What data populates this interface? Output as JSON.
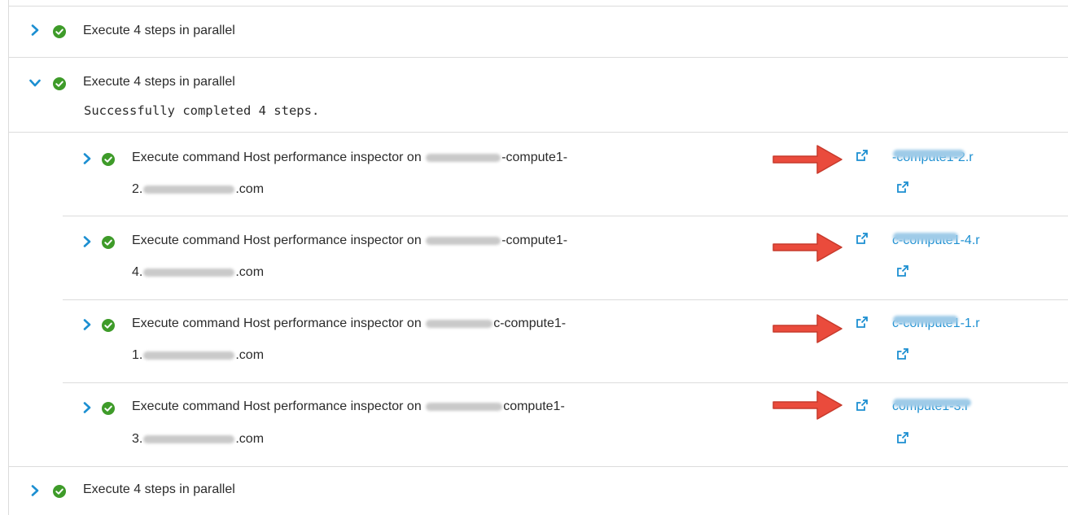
{
  "colors": {
    "accent": "#1c8fd1",
    "success": "#3e9b29",
    "arrow": "#ea4b3c"
  },
  "top_step": {
    "label": "Execute 4 steps in parallel",
    "expanded": false,
    "status": "success"
  },
  "expanded_step": {
    "label": "Execute 4 steps in parallel",
    "expanded": true,
    "status": "success",
    "message": "Successfully completed 4 steps.",
    "children": [
      {
        "line1_prefix": "Execute command Host performance inspector on",
        "line1_suffix": "-compute1-",
        "line2_prefix": "2.",
        "line2_suffix": ".com",
        "link_suffix": "-compute1-2.r"
      },
      {
        "line1_prefix": "Execute command Host performance inspector on",
        "line1_suffix": "-compute1-",
        "line2_prefix": "4.",
        "line2_suffix": ".com",
        "link_suffix": "c-compute1-4.r"
      },
      {
        "line1_prefix": "Execute command Host performance inspector on",
        "line1_suffix": "c-compute1-",
        "line2_prefix": "1.",
        "line2_suffix": ".com",
        "link_suffix": "c-compute1-1.r"
      },
      {
        "line1_prefix": "Execute command Host performance inspector on",
        "line1_suffix": "compute1-",
        "line2_prefix": "3.",
        "line2_suffix": ".com",
        "link_suffix": "compute1-3.r"
      }
    ]
  },
  "bottom_step": {
    "label": "Execute 4 steps in parallel",
    "expanded": false,
    "status": "success"
  },
  "icons": {
    "collapsed": "chevron-right-icon",
    "expanded": "chevron-down-icon",
    "status": "check-circle-icon",
    "open": "external-link-icon",
    "annotation": "red-arrow-icon"
  }
}
